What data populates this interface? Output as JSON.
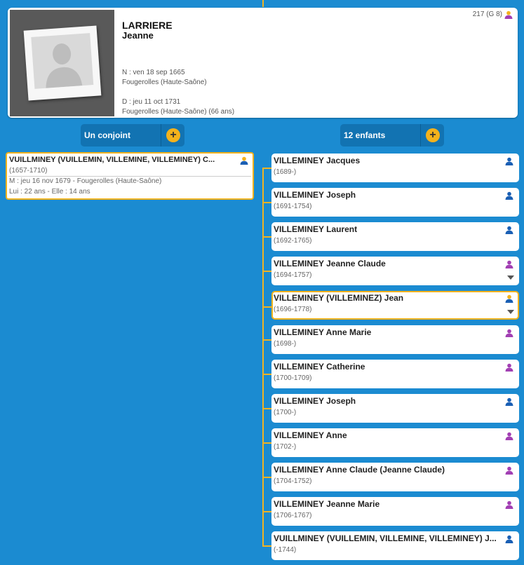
{
  "person": {
    "lastname": "LARRIERE",
    "firstname": "Jeanne",
    "birth": "N : ven 18 sep 1665",
    "birth_place": "Fougerolles (Haute-Saône)",
    "death": "D : jeu 11 oct 1731",
    "death_place": "Fougerolles (Haute-Saône) (66 ans)",
    "sosa": "217 (G 8)",
    "gender_icon": "user-icon-female-selected"
  },
  "tabs": {
    "spouse_label": "Un conjoint",
    "children_label": "12 enfants",
    "plus": "+"
  },
  "spouse": {
    "name": "VUILLMINEY (VUILLEMIN, VILLEMINE, VILLEMINEY) C...",
    "dates": "(1657-1710)",
    "marriage": "M : jeu 16 nov 1679 - Fougerolles (Haute-Saône)",
    "ages": "Lui : 22 ans - Elle : 14 ans"
  },
  "colors": {
    "background": "#1b8bd1",
    "accent": "#f4b21c",
    "male": "#1a5fb4",
    "female": "#a23fb3"
  },
  "children": [
    {
      "name": "VILLEMINEY Jacques",
      "dates": "(1689-)",
      "sex": "male"
    },
    {
      "name": "VILLEMINEY Joseph",
      "dates": "(1691-1754)",
      "sex": "male"
    },
    {
      "name": "VILLEMINEY Laurent",
      "dates": "(1692-1765)",
      "sex": "male"
    },
    {
      "name": "VILLEMINEY Jeanne Claude",
      "dates": "(1694-1757)",
      "sex": "female"
    },
    {
      "name": "VILLEMINEY (VILLEMINEZ) Jean",
      "dates": "(1696-1778)",
      "sex": "male"
    },
    {
      "name": "VILLEMINEY Anne Marie",
      "dates": "(1698-)",
      "sex": "female"
    },
    {
      "name": "VILLEMINEY Catherine",
      "dates": "(1700-1709)",
      "sex": "female"
    },
    {
      "name": "VILLEMINEY Joseph",
      "dates": "(1700-)",
      "sex": "male"
    },
    {
      "name": "VILLEMINEY Anne",
      "dates": "(1702-)",
      "sex": "female"
    },
    {
      "name": "VILLEMINEY Anne Claude (Jeanne Claude)",
      "dates": "(1704-1752)",
      "sex": "female"
    },
    {
      "name": "VILLEMINEY Jeanne Marie",
      "dates": "(1706-1767)",
      "sex": "female"
    },
    {
      "name": "VUILLMINEY (VUILLEMIN, VILLEMINE, VILLEMINEY) J...",
      "dates": "(-1744)",
      "sex": "male"
    }
  ]
}
